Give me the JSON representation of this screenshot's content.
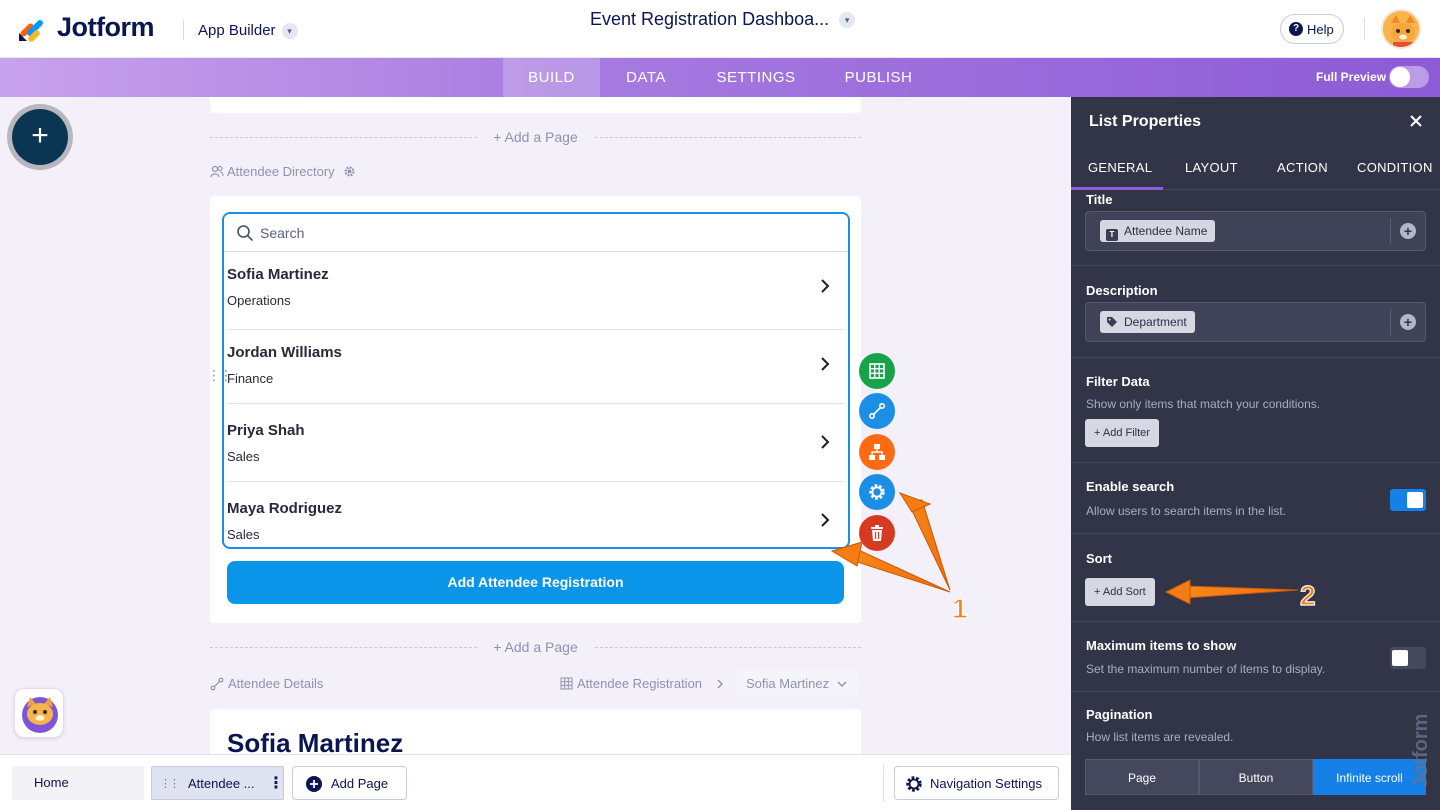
{
  "header": {
    "brand": "Jotform",
    "app_builder_label": "App Builder",
    "title": "Event Registration Dashboa...",
    "help_label": "Help"
  },
  "nav": {
    "tabs": [
      "BUILD",
      "DATA",
      "SETTINGS",
      "PUBLISH"
    ],
    "active_tab": "BUILD",
    "full_preview_label": "Full Preview"
  },
  "canvas": {
    "add_page_label": "+ Add a Page",
    "directory_page_label": "Attendee Directory",
    "search_placeholder": "Search",
    "list_items": [
      {
        "name": "Sofia Martinez",
        "dept": "Operations"
      },
      {
        "name": "Jordan Williams",
        "dept": "Finance"
      },
      {
        "name": "Priya Shah",
        "dept": "Sales"
      },
      {
        "name": "Maya Rodriguez",
        "dept": "Sales"
      }
    ],
    "primary_button": "Add Attendee Registration",
    "details_page_label": "Attendee Details",
    "breadcrumb_source": "Attendee Registration",
    "breadcrumb_record": "Sofia Martinez",
    "detail_title": "Sofia Martinez"
  },
  "bottom_bar": {
    "home": "Home",
    "current_page": "Attendee ...",
    "add_page": "Add Page",
    "navigation_settings": "Navigation Settings"
  },
  "panel": {
    "title": "List Properties",
    "tabs": [
      "GENERAL",
      "LAYOUT",
      "ACTION",
      "CONDITION"
    ],
    "active_tab": "GENERAL",
    "title_label": "Title",
    "title_value": "Attendee Name",
    "description_label": "Description",
    "description_value": "Department",
    "filter_label": "Filter Data",
    "filter_help": "Show only items that match your conditions.",
    "add_filter": "+ Add Filter",
    "search_label": "Enable search",
    "search_help": "Allow users to search items in the list.",
    "search_enabled": true,
    "sort_label": "Sort",
    "add_sort": "+ Add Sort",
    "max_label": "Maximum items to show",
    "max_help": "Set the maximum number of items to display.",
    "max_enabled": false,
    "pagination_label": "Pagination",
    "pagination_help": "How list items are revealed.",
    "pagination_options": [
      "Page",
      "Button",
      "Infinite scroll"
    ],
    "pagination_selected": "Infinite scroll"
  },
  "annotations": {
    "callout_1": "1",
    "callout_2": "2"
  },
  "colors": {
    "accent_blue": "#0a95e8",
    "panel_bg": "#323547",
    "nav_purple": "#a67be0",
    "callout_orange": "#f57c12"
  }
}
